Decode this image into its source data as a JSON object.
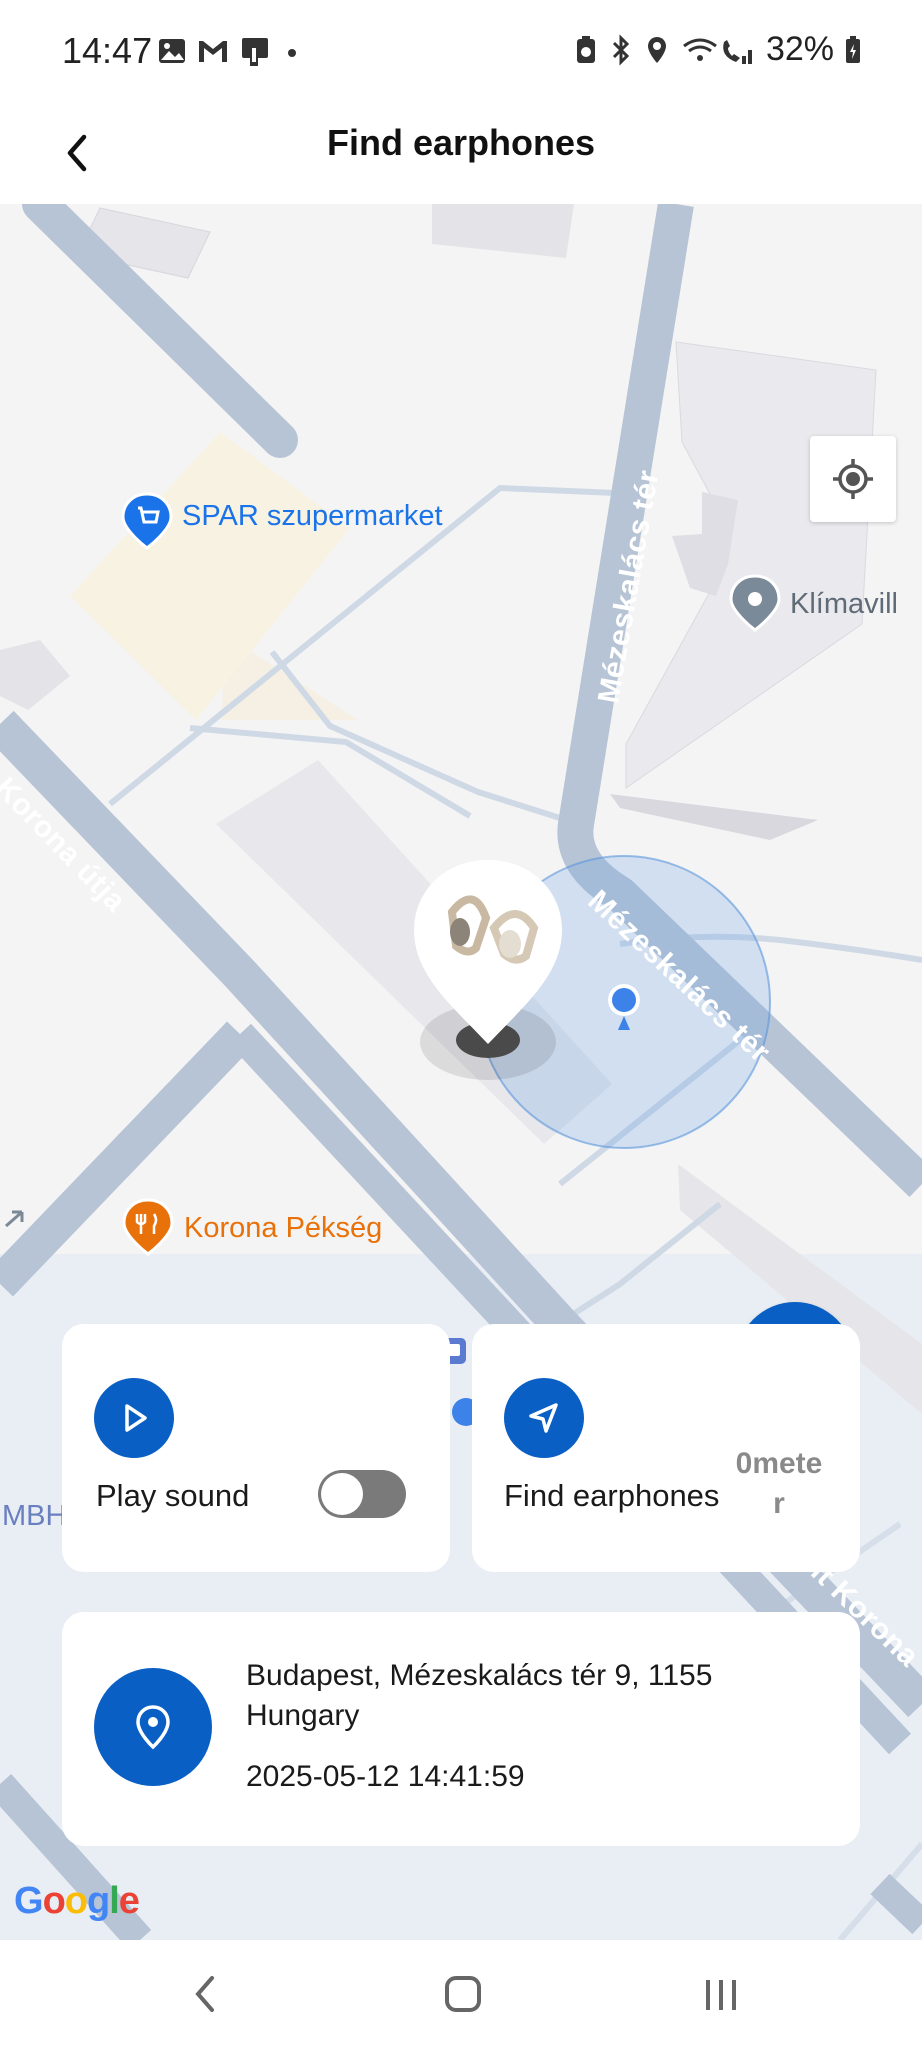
{
  "status_bar": {
    "time": "14:47",
    "battery_text": "32%",
    "icons_left": [
      "image-icon",
      "gmail-icon",
      "mobile-data-icon",
      "dot-icon"
    ],
    "icons_right": [
      "battery-saver-icon",
      "bluetooth-icon",
      "location-icon",
      "wifi-calling-icon",
      "signal-icon",
      "battery-icon"
    ]
  },
  "header": {
    "title": "Find earphones",
    "back_icon": "chevron-left-icon"
  },
  "map": {
    "pois": {
      "spar": "SPAR szupermarket",
      "klima": "Klímavill",
      "pekseg": "Korona Pékség",
      "mbh": "MBH"
    },
    "roads": {
      "mezeskalacs_vertical": "Mézeskalács tér",
      "mezeskalacs_diag": "Mézeskalács tér",
      "korona_left": "nt Korona útja",
      "korona_right": "nt Korona"
    },
    "google_logo": "Google",
    "colors": {
      "accent": "#0a5fc4",
      "spar_label": "#1a73e8",
      "pekseg_label": "#e8710a",
      "road": "#b6c5d6"
    }
  },
  "cards": {
    "play_sound": {
      "label": "Play sound",
      "icon": "play-icon",
      "toggle_on": false
    },
    "find": {
      "label": "Find earphones",
      "distance": "0meter",
      "icon": "navigation-arrow-icon"
    },
    "address": {
      "text": "Budapest, Mézeskalács tér 9, 1155 Hungary",
      "timestamp": "2025-05-12 14:41:59",
      "icon": "location-pin-icon"
    }
  },
  "nav_bar": {
    "back_icon": "nav-back-icon",
    "home_icon": "nav-home-icon",
    "recents_icon": "nav-recents-icon"
  }
}
